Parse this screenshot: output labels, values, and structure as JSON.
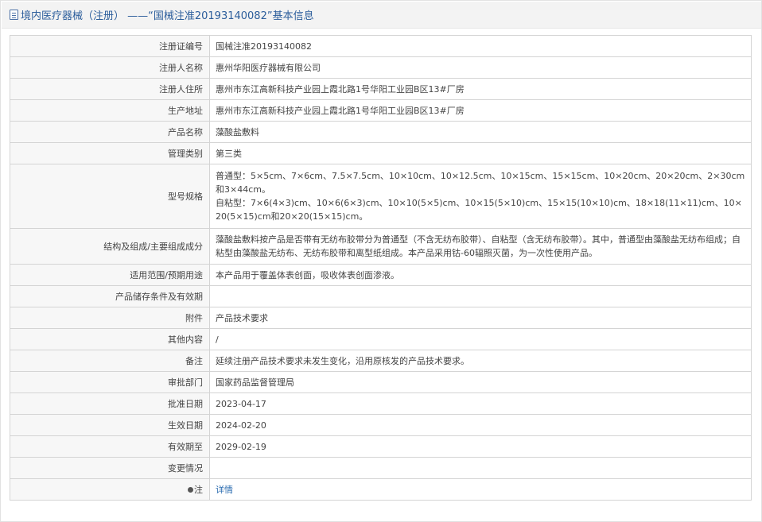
{
  "header": {
    "title": "境内医疗器械（注册） ——“国械注准20193140082”基本信息"
  },
  "rows": [
    {
      "label": "注册证编号",
      "value": "国械注准20193140082"
    },
    {
      "label": "注册人名称",
      "value": "惠州华阳医疗器械有限公司"
    },
    {
      "label": "注册人住所",
      "value": "惠州市东江高新科技产业园上霞北路1号华阳工业园B区13#厂房"
    },
    {
      "label": "生产地址",
      "value": "惠州市东江高新科技产业园上霞北路1号华阳工业园B区13#厂房"
    },
    {
      "label": "产品名称",
      "value": "藻酸盐敷料"
    },
    {
      "label": "管理类别",
      "value": "第三类"
    },
    {
      "label": "型号规格",
      "value": "普通型：5×5cm、7×6cm、7.5×7.5cm、10×10cm、10×12.5cm、10×15cm、15×15cm、10×20cm、20×20cm、2×30cm和3×44cm。\n自粘型：7×6(4×3)cm、10×6(6×3)cm、10×10(5×5)cm、10×15(5×10)cm、15×15(10×10)cm、18×18(11×11)cm、10×20(5×15)cm和20×20(15×15)cm。"
    },
    {
      "label": "结构及组成/主要组成成分",
      "value": "藻酸盐敷料按产品是否带有无纺布胶带分为普通型（不含无纺布胶带）、自粘型（含无纺布胶带）。其中，普通型由藻酸盐无纺布组成；自粘型由藻酸盐无纺布、无纺布胶带和离型纸组成。本产品采用钴-60辐照灭菌，为一次性使用产品。"
    },
    {
      "label": "适用范围/预期用途",
      "value": "本产品用于覆盖体表创面，吸收体表创面渗液。"
    },
    {
      "label": "产品储存条件及有效期",
      "value": ""
    },
    {
      "label": "附件",
      "value": "产品技术要求"
    },
    {
      "label": "其他内容",
      "value": "/"
    },
    {
      "label": "备注",
      "value": "延续注册产品技术要求未发生变化，沿用原核发的产品技术要求。"
    },
    {
      "label": "审批部门",
      "value": "国家药品监督管理局"
    },
    {
      "label": "批准日期",
      "value": "2023-04-17"
    },
    {
      "label": "生效日期",
      "value": "2024-02-20"
    },
    {
      "label": "有效期至",
      "value": "2029-02-19"
    },
    {
      "label": "变更情况",
      "value": ""
    }
  ],
  "note": {
    "label": "注",
    "link": "详情",
    "icon": "pin-icon"
  }
}
